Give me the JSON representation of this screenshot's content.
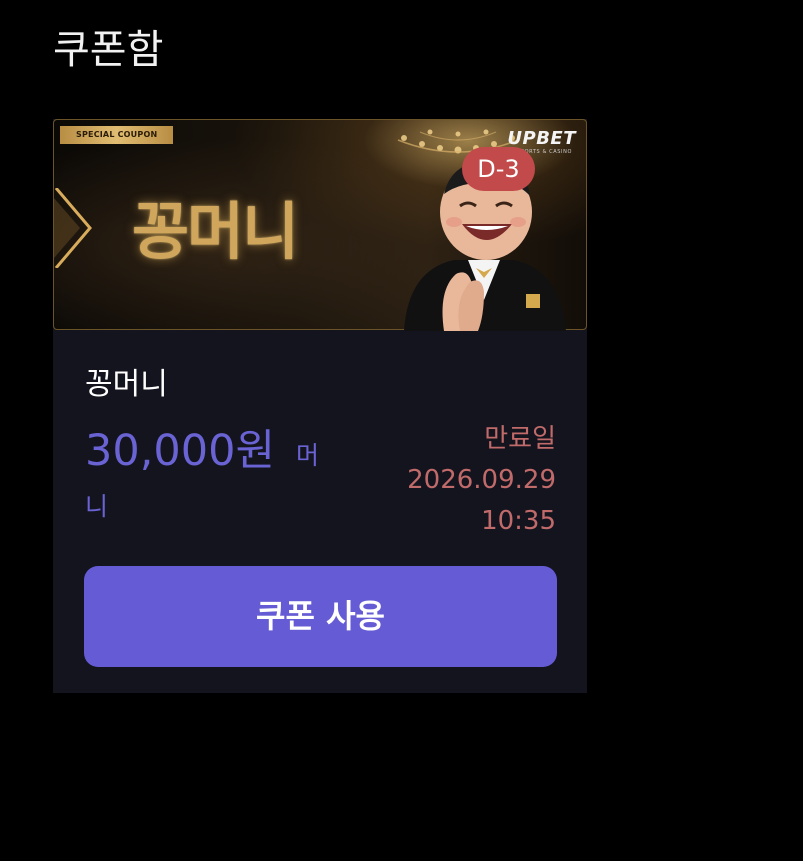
{
  "page": {
    "title": "쿠폰함"
  },
  "coupon": {
    "banner": {
      "tag": "SPECIAL COUPON",
      "title": "꽁머니",
      "brand": "UPBET",
      "brand_sub": "SPORTS & CASINO"
    },
    "dday": "D-3",
    "name": "꽁머니",
    "amount": "30,000원",
    "unit_part1": "머",
    "unit_part2": "니",
    "expiry_label": "만료일",
    "expiry_date": "2026.09.29",
    "expiry_time": "10:35",
    "use_button": "쿠폰 사용"
  },
  "colors": {
    "background": "#000000",
    "card": "#14141f",
    "accent": "#655bd4",
    "amount": "#6a63d4",
    "expiry": "#c06a6a",
    "dday_badge": "#c24a4a",
    "banner_gold": "#cfa65c"
  },
  "icons": {
    "chevron": "chevron-right-icon",
    "mascot": "mascot-character-icon",
    "chandelier": "chandelier-icon"
  }
}
